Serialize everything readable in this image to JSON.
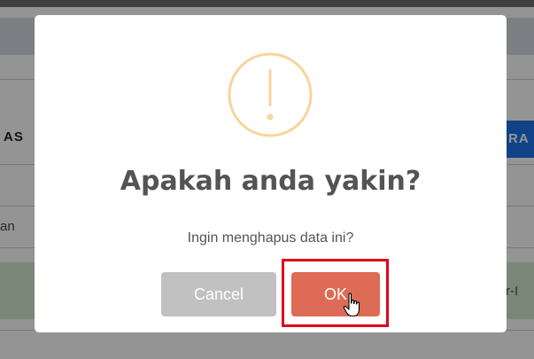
{
  "background": {
    "left_column_fragment": "AS",
    "right_button_fragment": "RA",
    "left_cell_fragment": "an",
    "right_cell_fragment": "r-I"
  },
  "dialog": {
    "icon": "warning-exclamation-icon",
    "title": "Apakah anda yakin?",
    "text": "Ingin menghapus data ini?",
    "cancel_label": "Cancel",
    "confirm_label": "OK"
  },
  "colors": {
    "icon_outline": "#f8d49a",
    "cancel_button": "#c1c1c1",
    "confirm_button": "#dd6b55",
    "highlight_box": "#e0001b",
    "background_accent_button": "#1a73e8",
    "background_highlight_row": "#cfe8cf"
  },
  "pointer": {
    "icon": "hand-pointer-cursor-icon"
  }
}
